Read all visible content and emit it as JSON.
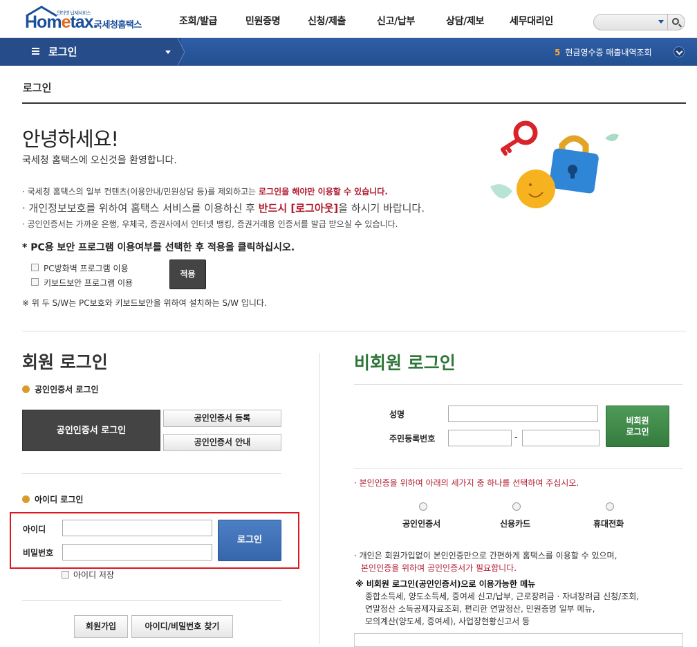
{
  "header": {
    "logo_sub": "인터넷 납세서비스",
    "logo_brand_a": "Hom",
    "logo_brand_b": "e",
    "logo_brand_c": "tax.",
    "logo_kor": "국세청홈택스",
    "menu": [
      "조회/발급",
      "민원증명",
      "신청/제출",
      "신고/납부",
      "상담/제보",
      "세무대리인"
    ]
  },
  "navbar": {
    "title": "로그인",
    "notice_num": "5",
    "notice_text": "현금영수증 매출내역조회"
  },
  "page": {
    "title": "로그인",
    "hello": "안녕하세요!",
    "welcome": "국세청 홈택스에 오신것을 환영합니다.",
    "bullet1_a": "· 국세청 홈택스의 일부 컨텐츠(이용안내/민원상담 등)를 제외하고는 ",
    "bullet1_b": "로그인을 해야만 이용할 수 있습니다.",
    "bullet2_a": "· 개인정보보호를 위하여 홈택스 서비스를 이용하신 후 ",
    "bullet2_b": "반드시 [로그아웃]",
    "bullet2_c": "을 하시기 바랍니다.",
    "bullet3": "· 공인인증서는 가까운 은행, 우체국, 증권사에서 인터넷 뱅킹, 증권거래용 인증서를 발급 받으실 수 있습니다.",
    "pc_title": "* PC용 보안 프로그램 이용여부를 선택한 후 적용을 클릭하십시오.",
    "pc_option1": "PC방화벽 프로그램 이용",
    "pc_option2": "키보드보안 프로그램 이용",
    "apply": "적용",
    "pc_note": "※ 위 두 S/W는 PC보호와 키보드보안을 위하여 설치하는 S/W 입니다."
  },
  "member": {
    "title": "회원 로그인",
    "cert_heading": "공인인증서 로그인",
    "cert_login": "공인인증서 로그인",
    "cert_register": "공인인증서 등록",
    "cert_guide": "공인인증서 안내",
    "id_heading": "아이디 로그인",
    "id_label": "아이디",
    "pw_label": "비밀번호",
    "login": "로그인",
    "save_id": "아이디 저장",
    "join": "회원가입",
    "find": "아이디/비밀번호 찾기"
  },
  "nonmember": {
    "title": "비회원 로그인",
    "name_label": "성명",
    "rrn_label": "주민등록번호",
    "dash": "-",
    "login": "비회원\n로그인",
    "login_line1": "비회원",
    "login_line2": "로그인",
    "select_notice": "· 본인인증을 위하여 아래의 세가지 중 하나를 선택하여 주십시오.",
    "methods": [
      "공인인증서",
      "신용카드",
      "휴대전화"
    ],
    "info1": "· 개인은 회원가입없이 본인인증만으로 간편하게 홈택스를 이용할 수 있으며,",
    "info2": "본인인증을 위하여 공인인증서가 필요합니다.",
    "menu_title": "※ 비회원 로그인(공인인증서)으로 이용가능한 메뉴",
    "menu1": "종합소득세, 양도소득세, 증여세 신고/납부, 근로장려금 · 자녀장려금 신청/조회,",
    "menu2": "연말정산 소득공제자료조회, 편리한 연말정산, 민원증명 일부 메뉴,",
    "menu3": "모의계산(양도세, 증여세), 사업장현황신고서 등"
  }
}
